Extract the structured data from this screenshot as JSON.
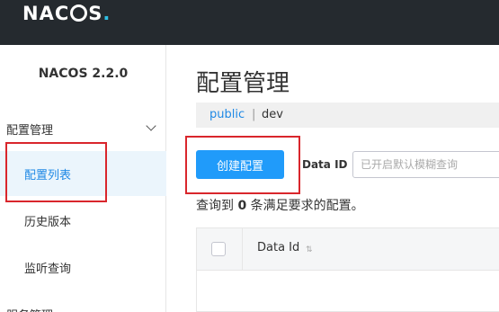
{
  "header": {
    "logo_text_pre": "NAC",
    "logo_text_post": "S",
    "logo_dot": "."
  },
  "sidebar": {
    "version_title": "NACOS 2.2.0",
    "group_label": "配置管理",
    "items": [
      {
        "label": "配置列表",
        "active": true
      },
      {
        "label": "历史版本",
        "active": false
      },
      {
        "label": "监听查询",
        "active": false
      }
    ],
    "next_group_label": "服务管理"
  },
  "main": {
    "title": "配置管理",
    "namespaces": {
      "current": "public",
      "separator": "|",
      "other": "dev"
    },
    "create_button_label": "创建配置",
    "search": {
      "label": "Data ID",
      "placeholder": "已开启默认模糊查询"
    },
    "query_result": {
      "prefix": "查询到",
      "count": "0",
      "suffix": "条满足要求的配置。"
    },
    "table": {
      "columns": [
        "Data Id"
      ],
      "sort_icon": "⇅"
    }
  },
  "colors": {
    "topbar": "#252a2f",
    "accent": "#209bfa",
    "link": "#1f89e5",
    "active_bg": "#ebf5fc",
    "highlight_box": "#d9262c"
  }
}
